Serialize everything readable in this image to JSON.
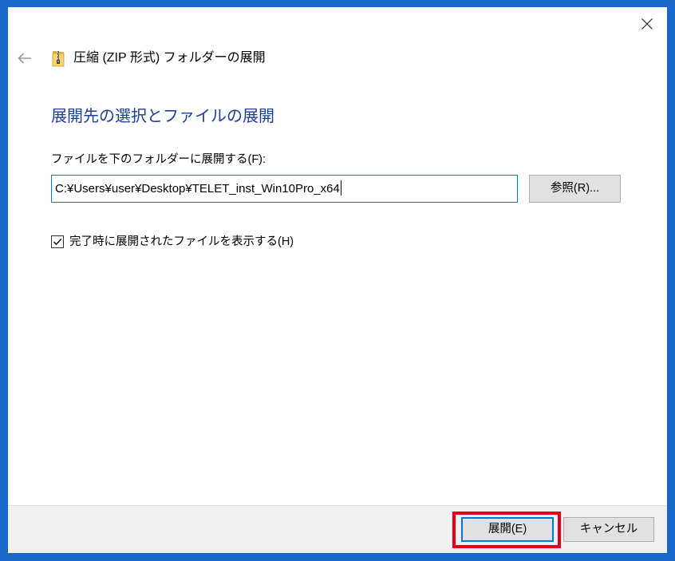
{
  "window": {
    "title": "圧縮 (ZIP 形式) フォルダーの展開"
  },
  "content": {
    "heading": "展開先の選択とファイルの展開",
    "destination": {
      "label": "ファイルを下のフォルダーに展開する(F):",
      "value": "C:¥Users¥user¥Desktop¥TELET_inst_Win10Pro_x64",
      "browse_label": "参照(R)..."
    },
    "show_files": {
      "label": "完了時に展開されたファイルを表示する(H)",
      "checked": true
    }
  },
  "footer": {
    "extract_label": "展開(E)",
    "cancel_label": "キャンセル"
  },
  "icons": {
    "back": "back-arrow-icon",
    "archive": "zip-folder-icon",
    "close": "close-icon",
    "check": "checkmark-icon"
  },
  "colors": {
    "frame": "#1b66c9",
    "heading": "#1c3f94",
    "focus_border": "#0078d7",
    "highlight": "#e3001b",
    "footer_bg": "#f0f0f0",
    "button_bg": "#e1e1e1"
  }
}
